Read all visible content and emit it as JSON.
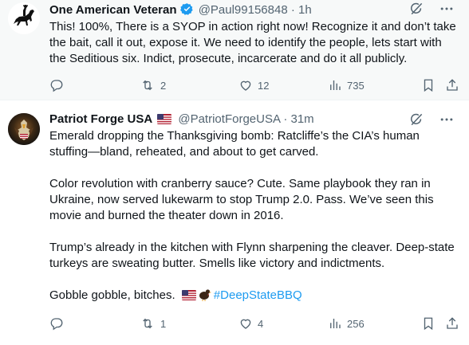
{
  "tweets": [
    {
      "display_name": "One American Veteran",
      "handle": "@Paul99156848",
      "separator": "·",
      "time": "1h",
      "text": [
        "This!  100%, There is a SYOP in action right now!  Recognize it and don’t take the bait, call it out, expose it.  We need to identify the people, lets start with the Seditious six.  Indict, prosecute, incarcerate and do it all publicly."
      ],
      "replies": "",
      "reposts": "2",
      "likes": "12",
      "views": "735"
    },
    {
      "display_name": "Patriot Forge USA",
      "handle": "@PatriotForgeUSA",
      "separator": "·",
      "time": "31m",
      "text": [
        "Emerald dropping the Thanksgiving bomb: Ratcliffe’s the CIA’s human stuffing—bland, reheated, and about to get carved.",
        "Color revolution with cranberry sauce? Cute. Same playbook they ran in Ukraine, now served lukewarm to stop Trump 2.0. Pass. We’ve seen this movie and burned the theater down in 2016.",
        "Trump’s already in the kitchen with Flynn sharpening the cleaver. Deep-state turkeys are sweating butter. Smells like victory and indictments."
      ],
      "last_line": "Gobble gobble, bitches.",
      "hashtag": "#DeepStateBBQ",
      "replies": "",
      "reposts": "1",
      "likes": "4",
      "views": "256"
    }
  ],
  "icons": {
    "verified": "verified-badge-icon",
    "flag": "us-flag-icon",
    "turkey": "turkey-icon",
    "grok": "grok-icon",
    "more": "more-icon",
    "reply": "reply-icon",
    "repost": "repost-icon",
    "like": "like-icon",
    "views": "views-icon",
    "bookmark": "bookmark-icon",
    "share": "share-icon"
  },
  "colors": {
    "accent": "#1d9bf0",
    "secondary_text": "#536471"
  }
}
